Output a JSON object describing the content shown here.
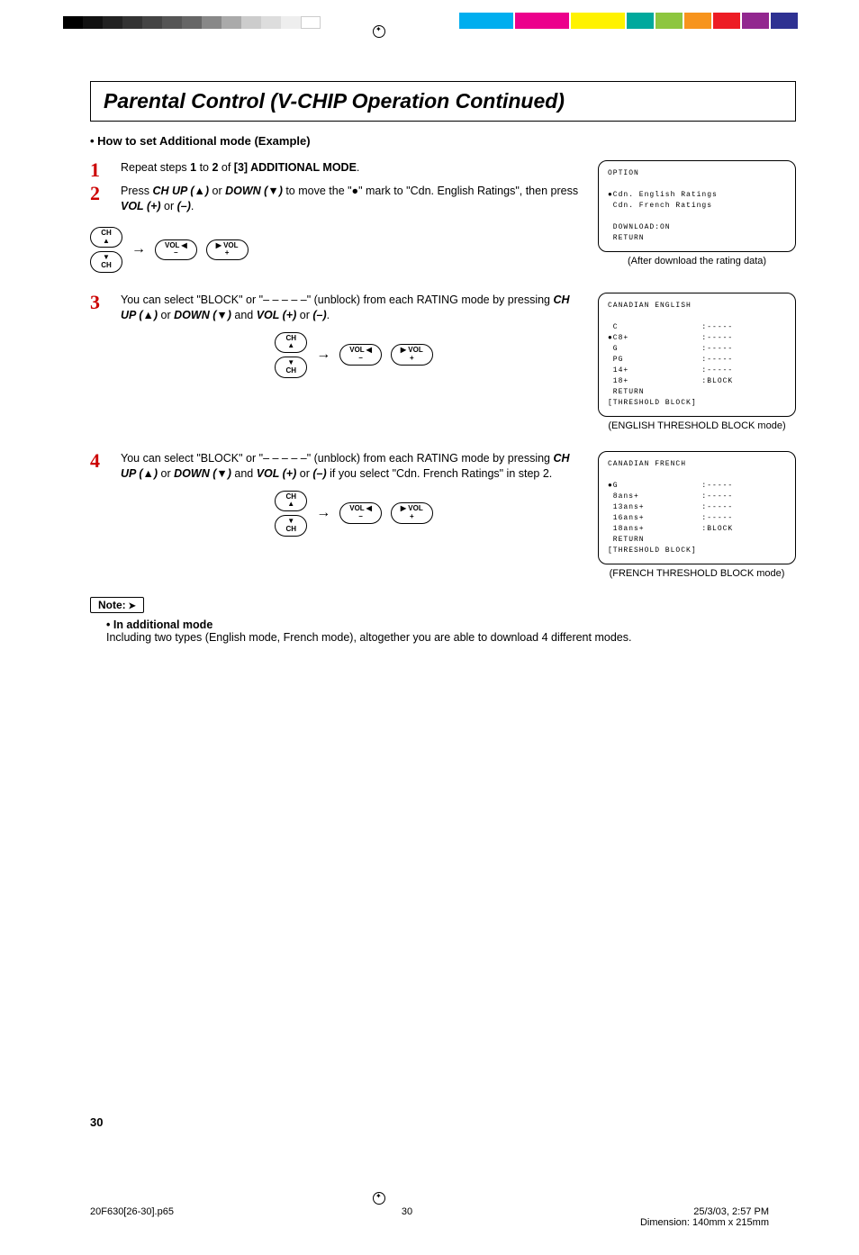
{
  "title": "Parental Control (V-CHIP Operation Continued)",
  "subhead": "• How to set Additional mode (Example)",
  "buttons": {
    "ch_up": "CH\n▲",
    "ch_down": "▼\nCH",
    "vol_minus": "VOL ◀\n–",
    "vol_plus": "▶ VOL\n+",
    "arrow": "→"
  },
  "steps": [
    {
      "num": "1",
      "html": "Repeat steps <b>1</b> to <b>2</b> of <b>[3] ADDITIONAL MODE</b>."
    },
    {
      "num": "2",
      "html": "Press <em class='bi'>CH UP (▲)</em> or <em class='bi'>DOWN (▼)</em> to move the \"●\" mark to \"Cdn. English Ratings\", then press <em class='bi'>VOL (+)</em> or <em class='bi'>(–)</em>."
    },
    {
      "num": "3",
      "html": "You can select \"BLOCK\" or \"– – – – –\" (unblock) from each RATING mode by pressing <em class='bi'>CH UP (▲)</em> or <em class='bi'>DOWN (▼)</em> and <em class='bi'>VOL (+)</em> or <em class='bi'>(–)</em>."
    },
    {
      "num": "4",
      "html": "You can select \"BLOCK\" or \"– – – – –\" (unblock) from each RATING mode by pressing <em class='bi'>CH UP (▲)</em> or <em class='bi'>DOWN (▼)</em> and <em class='bi'>VOL (+)</em> or <em class='bi'>(–)</em> if you select \"Cdn. French Ratings\" in step 2."
    }
  ],
  "osd1": {
    "title": "OPTION",
    "lines": [
      "●Cdn. English Ratings",
      " Cdn. French Ratings",
      "",
      " DOWNLOAD:ON",
      " RETURN"
    ],
    "caption": "(After download the rating data)"
  },
  "osd2": {
    "title": "CANADIAN ENGLISH",
    "rows": [
      [
        " C",
        ":-----"
      ],
      [
        "●C8+",
        ":-----"
      ],
      [
        " G",
        ":-----"
      ],
      [
        " PG",
        ":-----"
      ],
      [
        " 14+",
        ":-----"
      ],
      [
        " 18+",
        ":BLOCK"
      ],
      [
        " RETURN",
        ""
      ],
      [
        "[THRESHOLD BLOCK]",
        ""
      ]
    ],
    "caption": "(ENGLISH THRESHOLD BLOCK mode)"
  },
  "osd3": {
    "title": "CANADIAN FRENCH",
    "rows": [
      [
        "●G",
        ":-----"
      ],
      [
        " 8ans+",
        ":-----"
      ],
      [
        " 13ans+",
        ":-----"
      ],
      [
        " 16ans+",
        ":-----"
      ],
      [
        " 18ans+",
        ":BLOCK"
      ],
      [
        " RETURN",
        ""
      ],
      [
        "[THRESHOLD BLOCK]",
        ""
      ]
    ],
    "caption": "(FRENCH THRESHOLD BLOCK mode)"
  },
  "note": {
    "label": "Note:",
    "bullet": "• In additional mode",
    "text": "Including two types (English mode, French mode), altogether you are able to download 4 different modes."
  },
  "page_number": "30",
  "footer": {
    "file": "20F630[26-30].p65",
    "page": "30",
    "date": "25/3/03, 2:57 PM",
    "dimension": "Dimension: 140mm x 215mm"
  }
}
